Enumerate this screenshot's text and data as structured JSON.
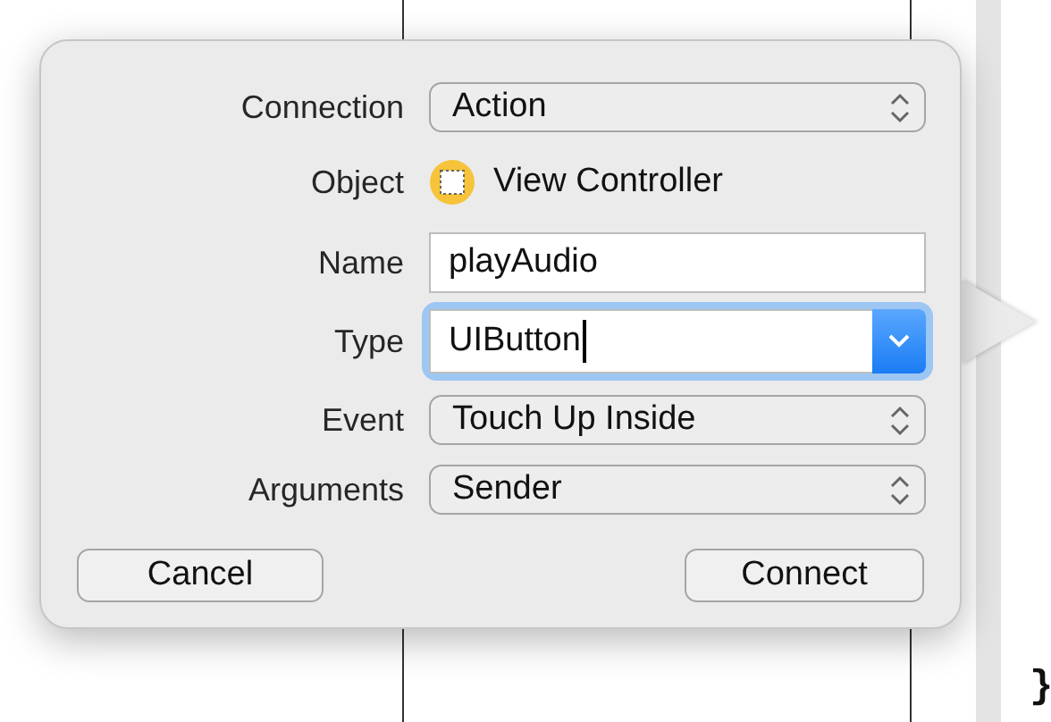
{
  "fields": [
    {
      "kind": "popup",
      "label": "Connection",
      "value": "Action",
      "focused": false
    },
    {
      "kind": "object",
      "label": "Object",
      "value": "View Controller",
      "focused": false
    },
    {
      "kind": "text",
      "label": "Name",
      "value": "playAudio",
      "focused": false
    },
    {
      "kind": "combo",
      "label": "Type",
      "value": "UIButton",
      "focused": true
    },
    {
      "kind": "popup",
      "label": "Event",
      "value": "Touch Up Inside",
      "focused": false
    },
    {
      "kind": "popup",
      "label": "Arguments",
      "value": "Sender",
      "focused": false
    }
  ],
  "buttons": [
    {
      "label": "Cancel"
    },
    {
      "label": "Connect"
    }
  ],
  "code_text": "}"
}
